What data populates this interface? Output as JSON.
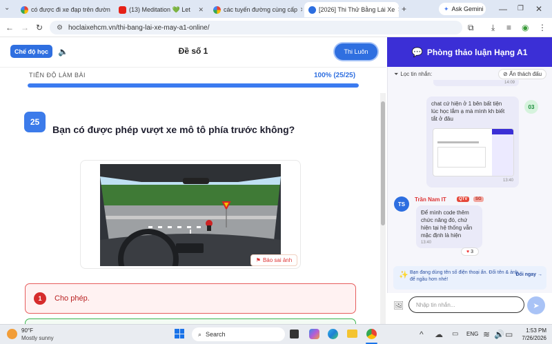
{
  "browser": {
    "tabs": [
      {
        "title": "có được đi xe đạp trên đườn",
        "favicon_color": "#4285f4"
      },
      {
        "title": "(13) Meditation 💚 Let",
        "favicon_color": "#e62117"
      },
      {
        "title": "các tuyến đường cùng cấp",
        "favicon_color": "#4285f4"
      },
      {
        "title": "[2026] Thi Thử Bằng Lái Xe",
        "favicon_color": "#2d6ee0"
      }
    ],
    "new_tab": "+",
    "ask_gemini": "Ask Gemini",
    "url": "hoclaixehcm.vn/thi-bang-lai-xe-may-a1-online/"
  },
  "header": {
    "mode_label": "Chế độ học",
    "title": "Đề số 1",
    "submit_label": "Thi Luôn"
  },
  "progress": {
    "label": "TIẾN ĐỘ LÀM BÀI",
    "value_text": "100% (25/25)",
    "fraction": 1.0
  },
  "question": {
    "number": "25",
    "text": "Bạn có được phép vượt xe mô tô phía trước không?",
    "report_label": "Báo sai ảnh"
  },
  "answers": [
    {
      "number": "1",
      "text": "Cho phép."
    }
  ],
  "chat": {
    "title": "Phòng thảo luận Hạng A1",
    "filter_label": "Lọc tin nhắn:",
    "hide_label": "Ẩn thách đấu",
    "top_time": "14:09",
    "msg1": {
      "text": "chat cứ hiện ở 1 bên bất tiện lúc học lắm ạ mà mình kh biết tắt ở đâu",
      "time": "13:40",
      "avatar": "03"
    },
    "msg2": {
      "sender": "Trần Nam IT",
      "badge1": "QTV",
      "badge2": "SG",
      "avatar": "TS",
      "text": "Để mình code thêm chức năng đó, chứ hiện tại hệ thống vẫn mặc định là hiện",
      "time": "13:40",
      "reaction": "3"
    },
    "notice": "Bạn đang dùng tên số điện thoại ẩn. Đổi tên & ảnh để ngầu hơn nhé!",
    "notice_action": "Đổi ngay →",
    "input_placeholder": "Nhập tin nhắn..."
  },
  "taskbar": {
    "weather_temp": "90°F",
    "weather_desc": "Mostly sunny",
    "search_label": "Search",
    "lang": "ENG",
    "time": "1:53 PM",
    "date": "7/26/2026"
  }
}
